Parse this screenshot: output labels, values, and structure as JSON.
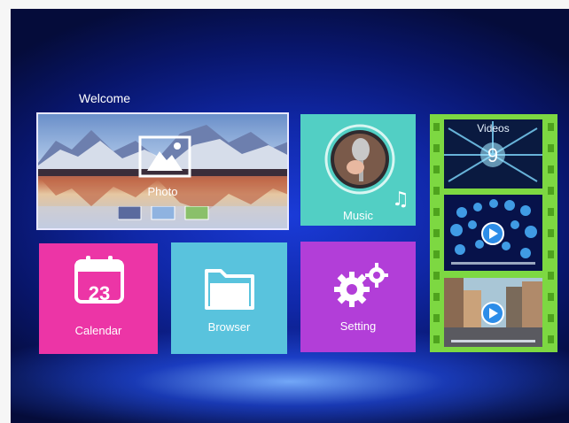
{
  "header": {
    "welcome": "Welcome"
  },
  "tiles": {
    "photo": {
      "label": "Photo"
    },
    "music": {
      "label": "Music"
    },
    "calendar": {
      "label": "Calendar",
      "day": "23"
    },
    "browser": {
      "label": "Browser"
    },
    "setting": {
      "label": "Setting"
    },
    "videos": {
      "label": "Videos",
      "number": "9"
    }
  },
  "colors": {
    "music": "#52cfc4",
    "calendar": "#ec35a6",
    "browser": "#59c3dd",
    "setting": "#b23ed8",
    "videos_strip": "#7dd842"
  },
  "icons": [
    "mountain-photo-icon",
    "microphone-icon",
    "music-note-icon",
    "calendar-icon",
    "folder-icon",
    "gear-icon",
    "play-icon"
  ]
}
